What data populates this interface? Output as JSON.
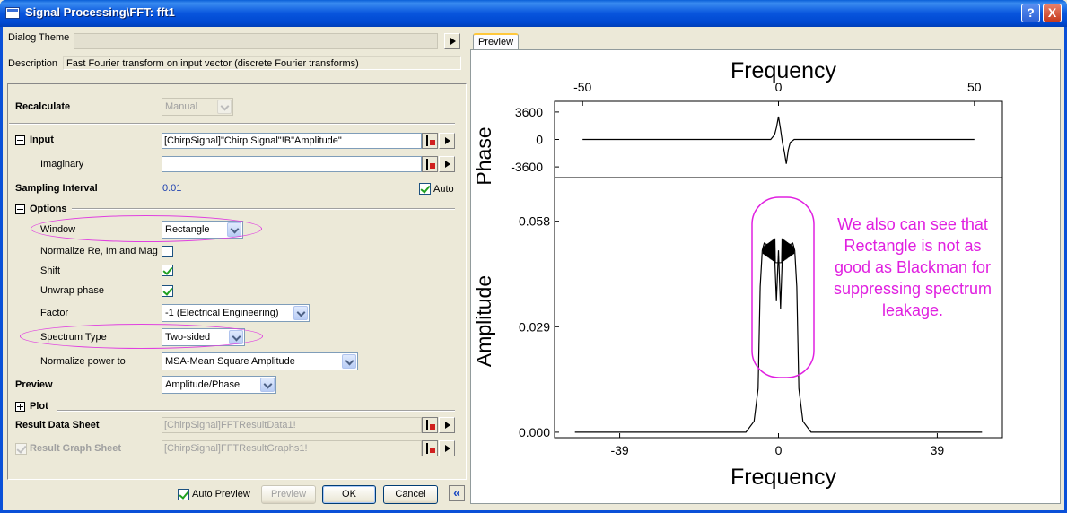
{
  "window": {
    "title": "Signal Processing\\FFT: fft1",
    "help": "?",
    "close": "X"
  },
  "header": {
    "theme_label": "Dialog Theme",
    "theme_value": "",
    "desc_label": "Description",
    "desc_value": "Fast Fourier transform on input vector (discrete Fourier transforms)"
  },
  "form": {
    "recalculate": {
      "label": "Recalculate",
      "value": "Manual"
    },
    "input": {
      "label": "Input",
      "value": "[ChirpSignal]\"Chirp Signal\"!B\"Amplitude\""
    },
    "imaginary": {
      "label": "Imaginary",
      "value": ""
    },
    "sampling": {
      "label": "Sampling Interval",
      "value": "0.01",
      "auto_label": "Auto",
      "auto_checked": true
    },
    "options": {
      "label": "Options"
    },
    "window": {
      "label": "Window",
      "value": "Rectangle"
    },
    "normalize": {
      "label": "Normalize Re, Im and Mag",
      "checked": false
    },
    "shift": {
      "label": "Shift",
      "checked": true
    },
    "unwrap": {
      "label": "Unwrap phase",
      "checked": true
    },
    "factor": {
      "label": "Factor",
      "value": "-1 (Electrical Engineering)"
    },
    "spectrum": {
      "label": "Spectrum Type",
      "value": "Two-sided"
    },
    "normpower": {
      "label": "Normalize power to",
      "value": "MSA-Mean Square Amplitude"
    },
    "preview": {
      "label": "Preview",
      "value": "Amplitude/Phase"
    },
    "plot": {
      "label": "Plot"
    },
    "result_data": {
      "label": "Result Data Sheet",
      "value": "[ChirpSignal]FFTResultData1!"
    },
    "result_graph": {
      "label": "Result Graph Sheet",
      "value": "[ChirpSignal]FFTResultGraphs1!"
    }
  },
  "footer": {
    "auto_preview": "Auto Preview",
    "preview_btn": "Preview",
    "ok": "OK",
    "cancel": "Cancel",
    "collapse": "«"
  },
  "preview_panel": {
    "tab": "Preview",
    "annotation": [
      "We also can see that",
      "Rectangle is not as",
      "good as Blackman for",
      "suppressing spectrum",
      "leakage."
    ],
    "annotation_color": "#e020e0"
  },
  "chart_data": [
    {
      "type": "line",
      "name": "phase",
      "ylabel": "Phase",
      "xlabel": "Frequency",
      "x_ticks": [
        "-50",
        "0",
        "50"
      ],
      "y_ticks": [
        "3600",
        "0",
        "-3600"
      ],
      "xlim": [
        -50,
        50
      ],
      "ylim": [
        -5000,
        5000
      ],
      "points": [
        [
          -50,
          0
        ],
        [
          -2,
          0
        ],
        [
          -1,
          600
        ],
        [
          -0.5,
          1600
        ],
        [
          0,
          3000
        ],
        [
          0.5,
          1400
        ],
        [
          1,
          -400
        ],
        [
          1.5,
          -1600
        ],
        [
          2,
          -3200
        ],
        [
          2.5,
          -1400
        ],
        [
          3,
          -400
        ],
        [
          4,
          0
        ],
        [
          50,
          0
        ]
      ]
    },
    {
      "type": "line",
      "name": "amplitude",
      "ylabel": "Amplitude",
      "xlabel": "Frequency",
      "x_ticks": [
        "-39",
        "0",
        "39"
      ],
      "y_ticks": [
        "0.058",
        "0.029",
        "0.000"
      ],
      "xlim": [
        -55,
        55
      ],
      "ylim": [
        -0.0015,
        0.07
      ],
      "points": [
        [
          -50,
          0
        ],
        [
          -8,
          0
        ],
        [
          -6,
          0.003
        ],
        [
          -5,
          0.012
        ],
        [
          -4.5,
          0.04
        ],
        [
          -4,
          0.05
        ],
        [
          -3.5,
          0.052
        ],
        [
          -2,
          0.051
        ],
        [
          -1,
          0.05
        ],
        [
          -0.5,
          0.036
        ],
        [
          0,
          0.05
        ],
        [
          0.5,
          0.034
        ],
        [
          1,
          0.05
        ],
        [
          2,
          0.051
        ],
        [
          3.5,
          0.052
        ],
        [
          4,
          0.05
        ],
        [
          4.5,
          0.04
        ],
        [
          5,
          0.012
        ],
        [
          6,
          0.003
        ],
        [
          8,
          0
        ],
        [
          50,
          0
        ]
      ]
    }
  ]
}
